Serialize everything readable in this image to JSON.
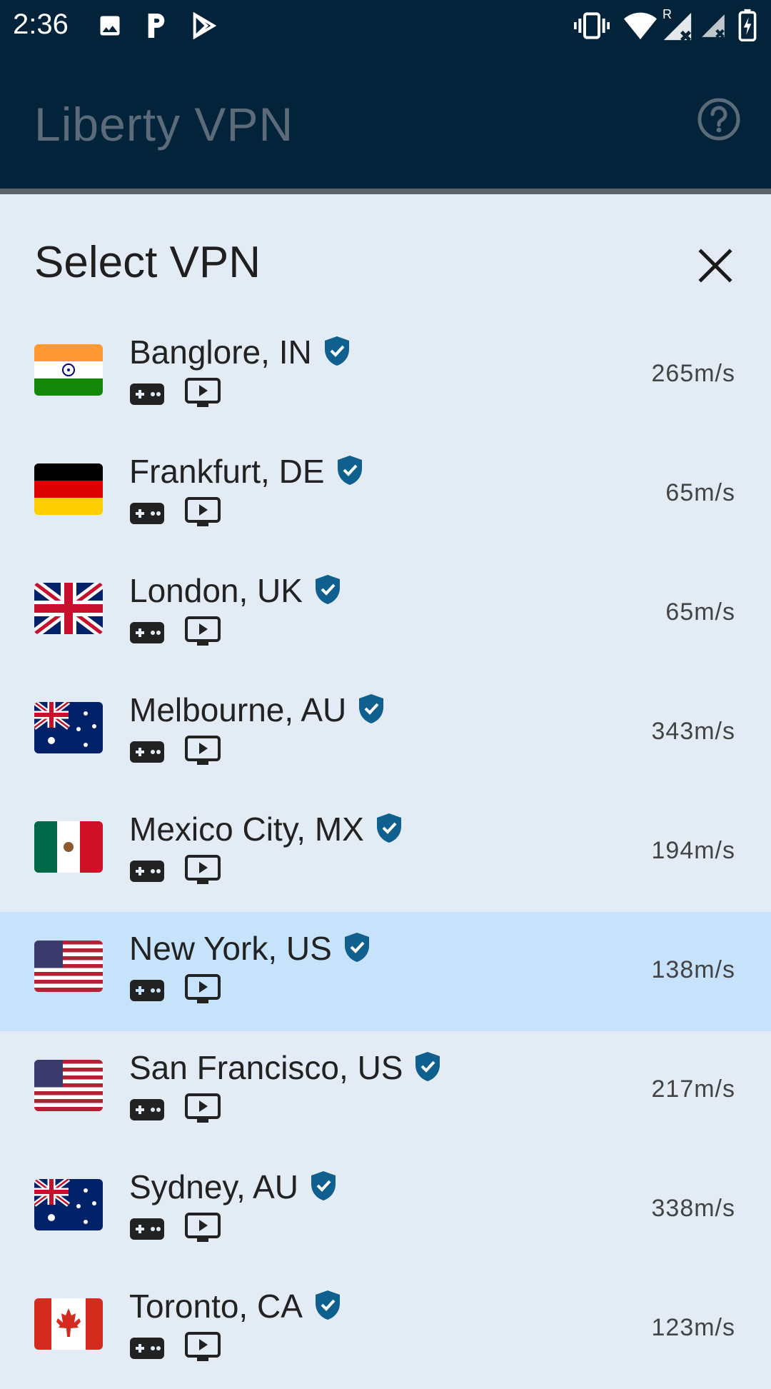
{
  "status_bar": {
    "time": "2:36",
    "left_icons": [
      "image-icon",
      "p-icon",
      "play-store-icon"
    ],
    "right_icons": [
      "vibrate-icon",
      "wifi-icon",
      "signal-roaming-icon",
      "signal-icon",
      "battery-charging-icon"
    ],
    "roaming_label": "R"
  },
  "app_bar": {
    "title": "Liberty VPN",
    "help_icon": "help-circle-icon"
  },
  "sheet": {
    "title": "Select VPN",
    "close_icon": "close-icon",
    "servers": [
      {
        "city": "Banglore, IN",
        "flag": "india-flag-icon",
        "speed": "265m/s",
        "selected": false
      },
      {
        "city": "Frankfurt, DE",
        "flag": "germany-flag-icon",
        "speed": "65m/s",
        "selected": false
      },
      {
        "city": "London, UK",
        "flag": "uk-flag-icon",
        "speed": "65m/s",
        "selected": false
      },
      {
        "city": "Melbourne, AU",
        "flag": "australia-flag-icon",
        "speed": "343m/s",
        "selected": false
      },
      {
        "city": "Mexico City, MX",
        "flag": "mexico-flag-icon",
        "speed": "194m/s",
        "selected": false
      },
      {
        "city": "New York, US",
        "flag": "usa-flag-icon",
        "speed": "138m/s",
        "selected": true
      },
      {
        "city": "San Francisco, US",
        "flag": "usa-flag-icon",
        "speed": "217m/s",
        "selected": false
      },
      {
        "city": "Sydney, AU",
        "flag": "australia-flag-icon",
        "speed": "338m/s",
        "selected": false
      },
      {
        "city": "Toronto, CA",
        "flag": "canada-flag-icon",
        "speed": "123m/s",
        "selected": false
      }
    ]
  },
  "colors": {
    "app_bar_bg": "#03233a",
    "sheet_bg": "#e3ebf4",
    "selected_row_bg": "#c7e2fb",
    "verified_badge": "#0f5f8f"
  }
}
